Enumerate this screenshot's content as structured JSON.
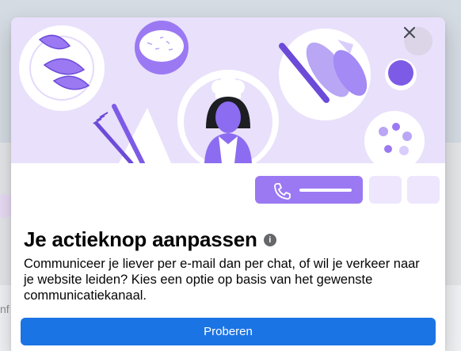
{
  "background": {
    "partial_text": "nf"
  },
  "dialog": {
    "title": "Je actieknop aanpassen",
    "description": "Communiceer je liever per e-mail dan per chat, of wil je verkeer naar je website leiden? Kies een optie op basis van het gewenste communicatiekanaal.",
    "primary_button_label": "Proberen",
    "close_icon": "close-icon",
    "info_icon": "info-icon",
    "action_preview": {
      "icon": "phone-icon"
    }
  },
  "colors": {
    "hero_background": "#e9e0fb",
    "accent_purple": "#9b79f3",
    "primary_blue": "#1b74e4"
  }
}
